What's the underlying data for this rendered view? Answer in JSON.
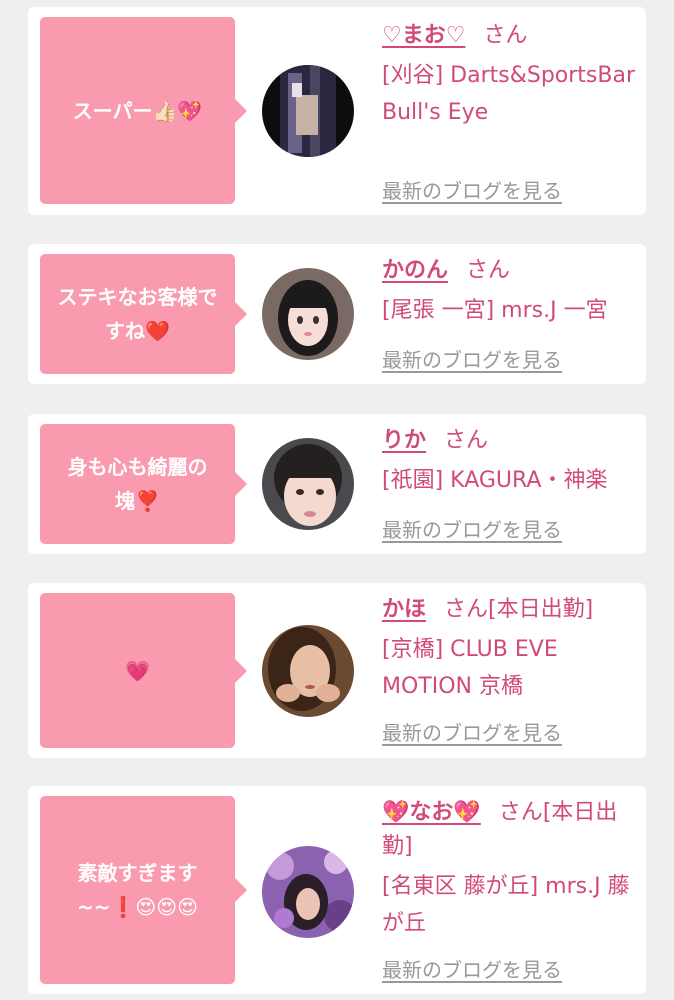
{
  "colors": {
    "background": "#efefef",
    "card": "#ffffff",
    "bubble": "#f99aae",
    "accent_text": "#d14b75",
    "link_gray": "#999999"
  },
  "entries": [
    {
      "comment": "スーパー👍🏻💖",
      "name": "♡まお♡",
      "honorific": "さん",
      "status": "",
      "shop": "[刈谷] Darts&SportsBar Bull's Eye",
      "blog_link": "最新のブログを見る"
    },
    {
      "comment": "ステキなお客様ですね❤️",
      "name": "かのん",
      "honorific": "さん",
      "status": "",
      "shop": "[尾張 一宮] mrs.J 一宮",
      "blog_link": "最新のブログを見る"
    },
    {
      "comment": "身も心も綺麗の塊❣️",
      "name": "りか",
      "honorific": "さん",
      "status": "",
      "shop": "[祇園] KAGURA・神楽",
      "blog_link": "最新のブログを見る"
    },
    {
      "comment": "💗",
      "name": "かほ",
      "honorific": "さん",
      "status": "[本日出勤]",
      "shop": "[京橋] CLUB EVE MOTION 京橋",
      "blog_link": "最新のブログを見る"
    },
    {
      "comment": "素敵すぎます~~❗😍😍😍",
      "name": "💖なお💖",
      "honorific": "さん",
      "status": "[本日出勤]",
      "shop": "[名東区 藤が丘] mrs.J 藤が丘",
      "blog_link": "最新のブログを見る"
    }
  ]
}
